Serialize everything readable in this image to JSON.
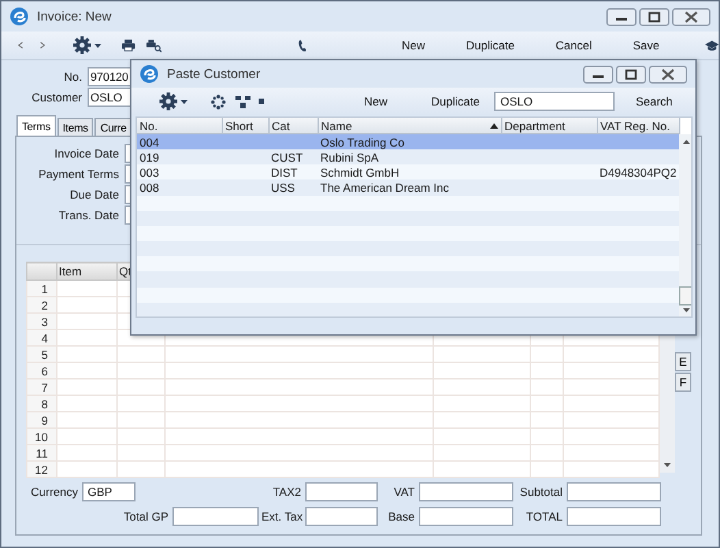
{
  "window": {
    "title": "Invoice: New"
  },
  "toolbar": {
    "buttons": [
      "New",
      "Duplicate",
      "Cancel",
      "Save"
    ]
  },
  "header_fields": [
    {
      "label": "No.",
      "value": "970120"
    },
    {
      "label": "Customer",
      "value": "OSLO"
    }
  ],
  "tabs": [
    {
      "label": "Terms",
      "selected": true
    },
    {
      "label": "Items",
      "selected": false
    },
    {
      "label": "Curre",
      "selected": false
    }
  ],
  "terms_fields": [
    {
      "label": "Invoice Date"
    },
    {
      "label": "Payment Terms"
    },
    {
      "label": "Due Date"
    },
    {
      "label": "Trans. Date"
    }
  ],
  "grid": {
    "columns": [
      "Item",
      "Qt"
    ],
    "row_numbers": [
      "1",
      "2",
      "3",
      "4",
      "5",
      "6",
      "7",
      "8",
      "9",
      "10",
      "11",
      "12"
    ]
  },
  "side_tabs": [
    "E",
    "F"
  ],
  "footer_rows": [
    [
      {
        "label": "Currency",
        "value": "GBP"
      },
      {
        "label": "TAX2"
      },
      {
        "label": "VAT"
      },
      {
        "label": "Subtotal"
      }
    ],
    [
      {
        "label": "Total GP"
      },
      {
        "label": "Ext. Tax"
      },
      {
        "label": "Base"
      },
      {
        "label": "TOTAL"
      }
    ]
  ],
  "dialog": {
    "title": "Paste Customer",
    "buttons": [
      "New",
      "Duplicate"
    ],
    "search": {
      "value": "OSLO"
    },
    "search_button": "Search",
    "table": {
      "columns": [
        {
          "label": "No.",
          "sorted": false
        },
        {
          "label": "Short",
          "sorted": false
        },
        {
          "label": "Cat",
          "sorted": false
        },
        {
          "label": "Name",
          "sorted": true
        },
        {
          "label": "Department",
          "sorted": false
        },
        {
          "label": "VAT Reg. No.",
          "sorted": false
        }
      ],
      "rows": [
        {
          "cells": [
            "004",
            "",
            "",
            "Oslo Trading Co",
            "",
            ""
          ],
          "selected": true
        },
        {
          "cells": [
            "019",
            "",
            "CUST",
            "Rubini SpA",
            "",
            ""
          ],
          "selected": false
        },
        {
          "cells": [
            "003",
            "",
            "DIST",
            "Schmidt GmbH",
            "",
            "D4948304PQ2"
          ],
          "selected": false
        },
        {
          "cells": [
            "008",
            "",
            "USS",
            "The American Dream Inc",
            "",
            ""
          ],
          "selected": false
        }
      ]
    }
  }
}
